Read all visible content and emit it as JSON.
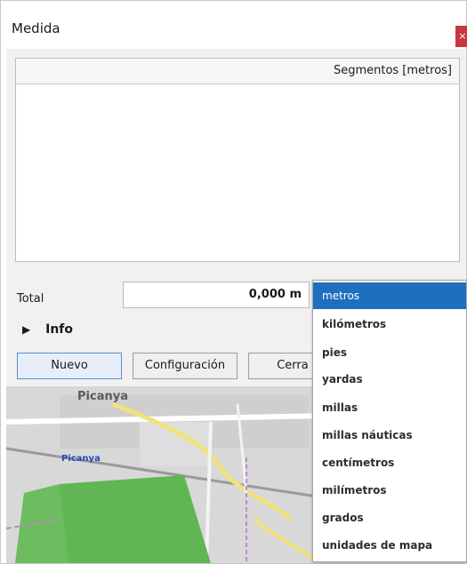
{
  "window": {
    "title": "Medida",
    "close_glyph": "×"
  },
  "segments": {
    "header": "Segmentos [metros]"
  },
  "total": {
    "label": "Total",
    "value": "0,000 m"
  },
  "info": {
    "label": "Info"
  },
  "buttons": {
    "nuevo": "Nuevo",
    "configuracion": "Configuración",
    "cerrar": "Cerra"
  },
  "units_dropdown": {
    "selected": "metros",
    "options": [
      "metros",
      "kilómetros",
      "pies",
      "yardas",
      "millas",
      "millas náuticas",
      "centímetros",
      "milímetros",
      "grados",
      "unidades de mapa"
    ]
  },
  "map": {
    "place_labels": [
      "Picanya",
      "Picanya"
    ]
  },
  "colors": {
    "selection": "#1e6fbe",
    "close": "#c7383f",
    "dialog_bg": "#f2f1f0",
    "park": "#5fb652",
    "road": "#efe37a"
  }
}
